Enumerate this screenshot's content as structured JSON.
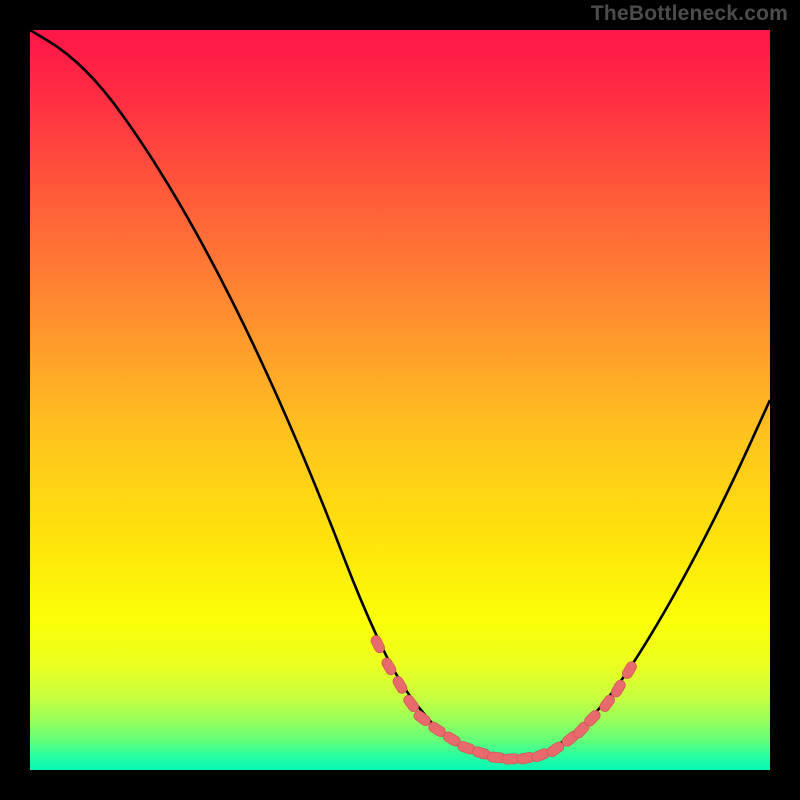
{
  "watermark": "TheBottleneck.com",
  "colors": {
    "page_bg": "#000000",
    "gradient": [
      "#ff1648",
      "#ff2a44",
      "#ff5a3a",
      "#ff8d30",
      "#ffc41e",
      "#ffe60a",
      "#fbff08",
      "#eaff22",
      "#caff3e",
      "#9cff58",
      "#63ff79",
      "#2bffa0",
      "#08f7b6"
    ],
    "curve_stroke": "#000000",
    "marker_fill": "#e86a6c",
    "marker_stroke": "#d35458"
  },
  "chart_data": {
    "type": "line",
    "title": "",
    "xlabel": "",
    "ylabel": "",
    "xlim": [
      0,
      100
    ],
    "ylim": [
      0,
      100
    ],
    "grid": false,
    "legend": false,
    "x": [
      0,
      5,
      10,
      15,
      20,
      25,
      30,
      35,
      40,
      45,
      50,
      55,
      56,
      58,
      60,
      63,
      65,
      68,
      70,
      75,
      80,
      85,
      90,
      95,
      100
    ],
    "values": [
      100,
      97,
      92,
      85,
      77,
      68,
      58,
      47,
      35,
      22,
      11.5,
      5.5,
      4.5,
      3.3,
      2.4,
      1.7,
      1.5,
      1.7,
      2.4,
      6,
      12,
      20,
      29,
      39,
      50
    ],
    "markers": {
      "x": [
        47,
        48.5,
        50,
        51.5,
        53,
        55,
        57,
        59,
        61,
        63,
        65,
        67,
        69,
        71,
        73,
        74.5,
        76,
        78,
        79.5,
        81
      ],
      "y": [
        17,
        14,
        11.5,
        9,
        7,
        5.5,
        4.2,
        3.0,
        2.3,
        1.7,
        1.5,
        1.6,
        2.0,
        2.8,
        4.2,
        5.4,
        7.0,
        9.0,
        11.0,
        13.5
      ]
    }
  }
}
